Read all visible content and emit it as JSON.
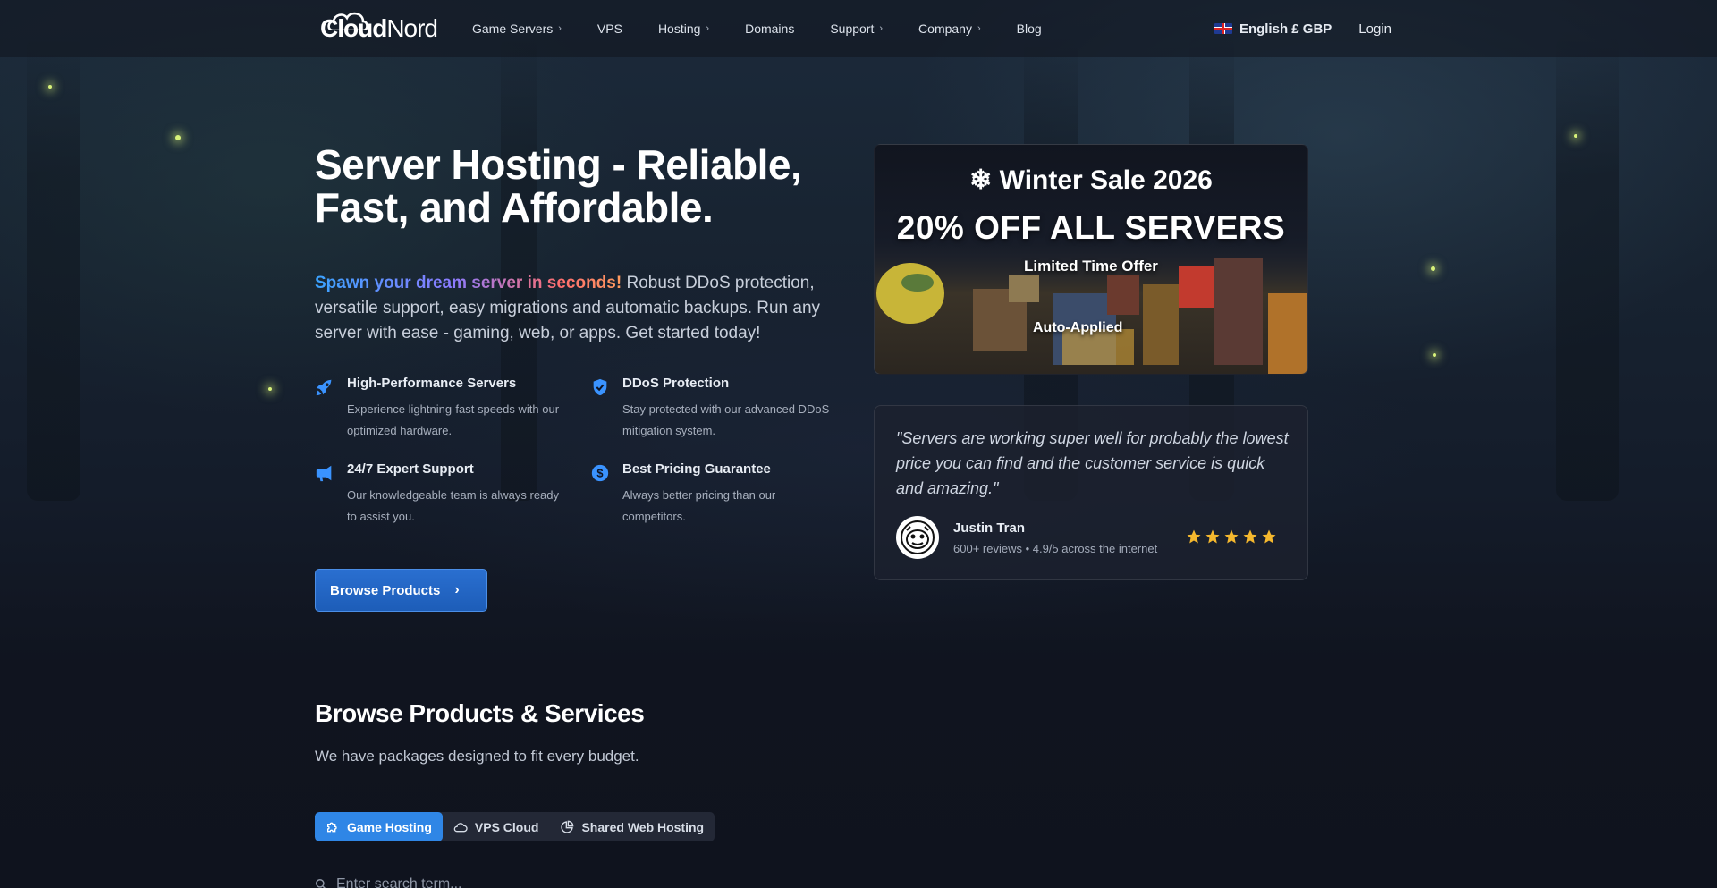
{
  "nav": {
    "logo_part1": "Cloud",
    "logo_part2": "Nord",
    "items": [
      {
        "label": "Game Servers",
        "has_dropdown": true
      },
      {
        "label": "VPS",
        "has_dropdown": false
      },
      {
        "label": "Hosting",
        "has_dropdown": true
      },
      {
        "label": "Domains",
        "has_dropdown": false
      },
      {
        "label": "Support",
        "has_dropdown": true
      },
      {
        "label": "Company",
        "has_dropdown": true
      },
      {
        "label": "Blog",
        "has_dropdown": false
      }
    ],
    "language": "English £ GBP",
    "login": "Login"
  },
  "hero": {
    "title": "Server Hosting - Reliable, Fast, and Affordable.",
    "tagline_highlight": "Spawn your dream server in seconds!",
    "tagline_rest": " Robust DDoS protection, versatile support, easy migrations and automatic backups. Run any server with ease - gaming, web, or apps. Get started today!",
    "features": [
      {
        "icon": "rocket-icon",
        "title": "High-Performance Servers",
        "desc": "Experience lightning-fast speeds with our optimized hardware."
      },
      {
        "icon": "shield-check-icon",
        "title": "DDoS Protection",
        "desc": "Stay protected with our advanced DDoS mitigation system."
      },
      {
        "icon": "megaphone-icon",
        "title": "24/7 Expert Support",
        "desc": "Our knowledgeable team is always ready to assist you."
      },
      {
        "icon": "dollar-circle-icon",
        "title": "Best Pricing Guarantee",
        "desc": "Always better pricing than our competitors."
      }
    ],
    "browse_button": "Browse Products"
  },
  "promo": {
    "title": "Winter Sale 2026",
    "headline": "20% OFF ALL SERVERS",
    "subtitle": "Limited Time Offer",
    "auto_applied": "Auto-Applied"
  },
  "review": {
    "quote": "\"Servers are working super well for probably the lowest price you can find and the customer service is quick and amazing.\"",
    "name": "Justin Tran",
    "meta": "600+ reviews • 4.9/5 across the internet",
    "rating": 5
  },
  "browse": {
    "title": "Browse Products & Services",
    "subtitle": "We have packages designed to fit every budget.",
    "tabs": [
      {
        "label": "Game Hosting",
        "icon": "puzzle-icon",
        "active": true
      },
      {
        "label": "VPS Cloud",
        "icon": "cloud-icon",
        "active": false
      },
      {
        "label": "Shared Web Hosting",
        "icon": "pie-chart-icon",
        "active": false
      }
    ],
    "search_placeholder": "Enter search term..."
  },
  "colors": {
    "accent": "#2f86e6",
    "star": "#f5b82e",
    "background": "#0f1320"
  }
}
